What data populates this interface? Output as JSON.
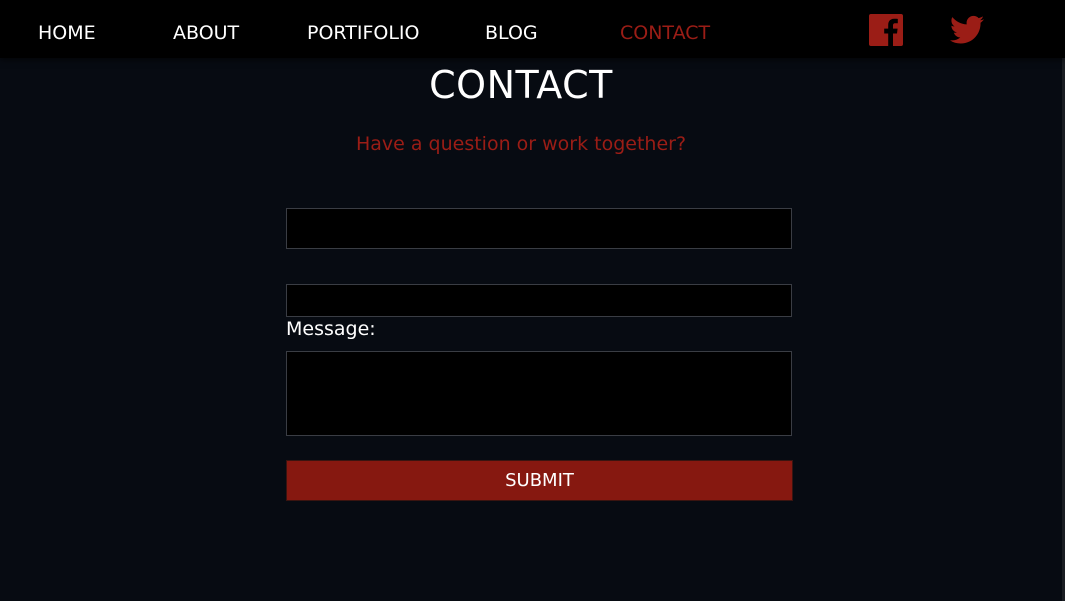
{
  "nav": {
    "items": [
      {
        "label": "HOME"
      },
      {
        "label": "ABOUT"
      },
      {
        "label": "PORTIFOLIO"
      },
      {
        "label": "BLOG"
      },
      {
        "label": "CONTACT",
        "active": true
      }
    ],
    "social": [
      {
        "icon": "facebook-icon"
      },
      {
        "icon": "twitter-icon"
      }
    ]
  },
  "main": {
    "title": "CONTACT",
    "subtitle": "Have a question or work together?",
    "form": {
      "name_value": "",
      "email_value": "",
      "message_label": "Message:",
      "message_value": "",
      "submit_label": "SUBMIT"
    }
  },
  "colors": {
    "background": "#070b12",
    "nav_background": "#000000",
    "accent": "#9b1d16",
    "button": "#861810",
    "text": "#ffffff"
  }
}
